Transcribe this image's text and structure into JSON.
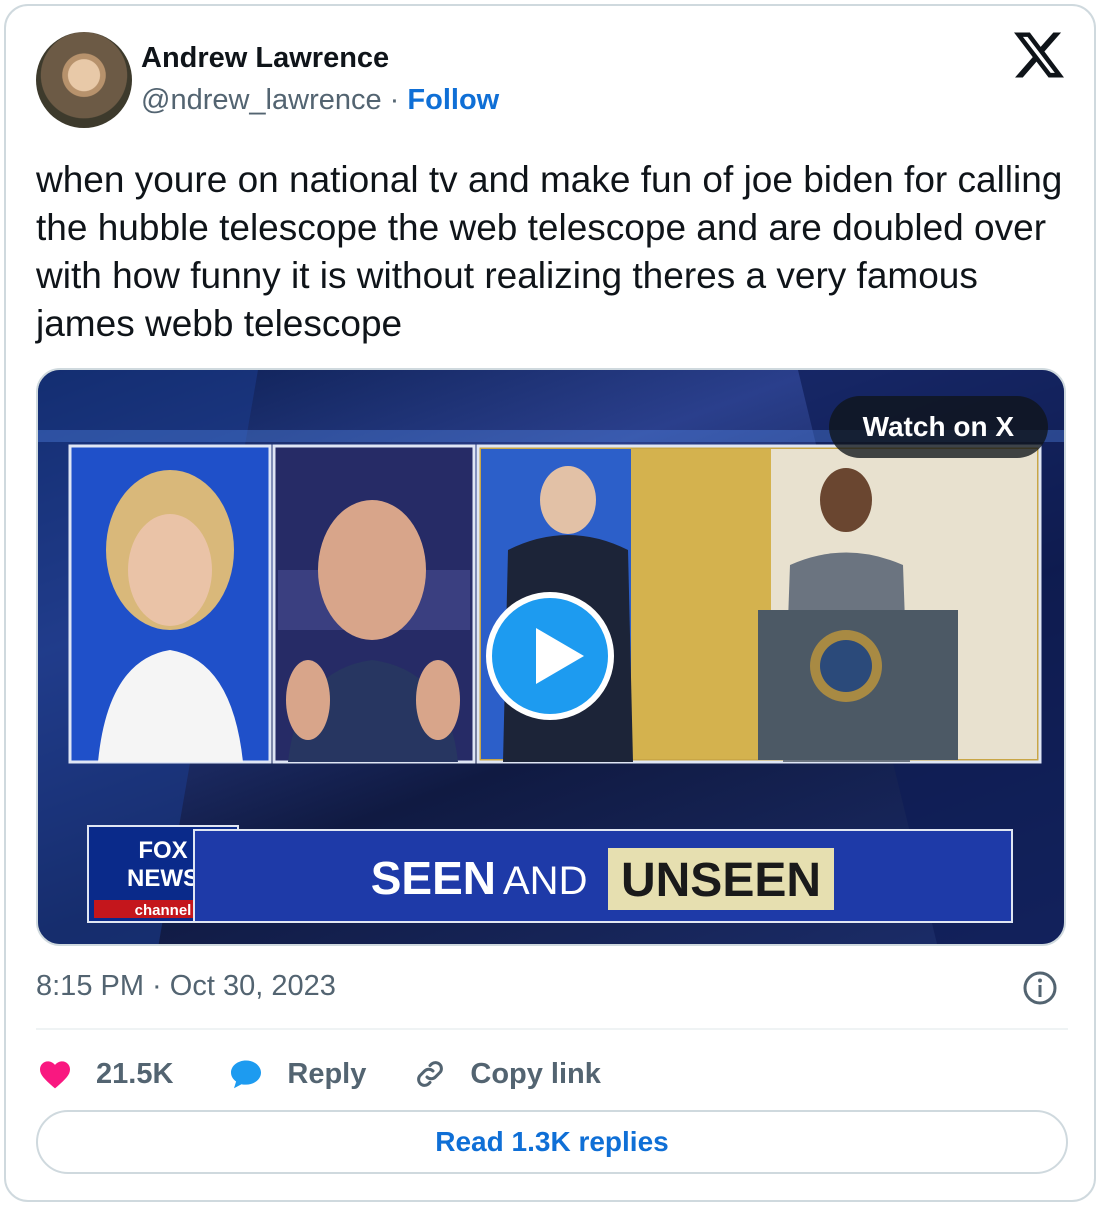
{
  "author": {
    "name": "Andrew Lawrence",
    "handle": "@ndrew_lawrence",
    "separator": "·",
    "follow_label": "Follow"
  },
  "tweet": {
    "text": "when youre on national tv and make fun of joe biden for calling the hubble telescope the web telescope and are doubled over with how funny it is without realizing theres a very famous james webb telescope",
    "timestamp": "8:15 PM · Oct 30, 2023"
  },
  "media": {
    "watch_label": "Watch on X",
    "chyron_part1": "SEEN",
    "chyron_part2": "AND",
    "chyron_part3": "UNSEEN",
    "network_line1": "FOX",
    "network_line2": "NEWS",
    "network_line3": "channel"
  },
  "actions": {
    "likes": "21.5K",
    "reply_label": "Reply",
    "copy_label": "Copy link"
  },
  "read_replies_label": "Read 1.3K replies",
  "colors": {
    "accent": "#0f6fd6",
    "like": "#f91880",
    "reply": "#1d9bf0",
    "muted": "#536471",
    "border": "#cfd9de"
  },
  "icons": [
    "x-logo-icon",
    "play-icon",
    "info-icon",
    "heart-icon",
    "reply-bubble-icon",
    "link-icon"
  ]
}
